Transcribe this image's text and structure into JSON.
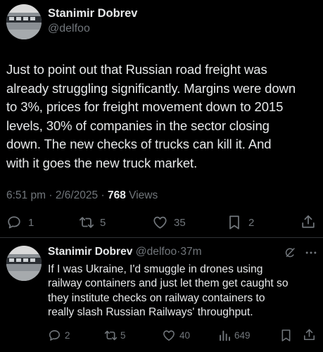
{
  "main_tweet": {
    "author_name": "Stanimir Dobrev",
    "handle": "@delfoo",
    "lines": [
      "Just to point out that Russian road freight was",
      "already struggling significantly. Margins were down",
      "to 3%, prices for freight movement down to 2015",
      "levels, 30% of companies in the sector closing",
      "down. The new checks of trucks can kill it. And",
      "with it goes the new truck market."
    ],
    "time": "6:51 pm",
    "sep1": "·",
    "date": "2/6/2025",
    "sep2": "·",
    "views_count": "768",
    "views_label": "Views",
    "replies": "1",
    "reposts": "5",
    "likes": "35",
    "bookmarks": "2"
  },
  "reply_tweet": {
    "author_name": "Stanimir Dobrev",
    "handle": "@delfoo",
    "sep": "·",
    "age": "37m",
    "lines": [
      "If I was Ukraine, I'd smuggle in drones using",
      "railway containers and just let them get caught so",
      "they institute checks on railway containers to",
      "really slash Russian Railways' throughput."
    ],
    "replies": "2",
    "reposts": "5",
    "likes": "40",
    "views": "649"
  },
  "colors": {
    "background": "#000000",
    "text": "#e7e9ea",
    "muted": "#71767b",
    "divider": "#2f3336"
  },
  "icons": [
    "reply-icon",
    "repost-icon",
    "like-icon",
    "bookmark-icon",
    "share-icon",
    "views-icon",
    "grok-icon",
    "more-icon"
  ]
}
